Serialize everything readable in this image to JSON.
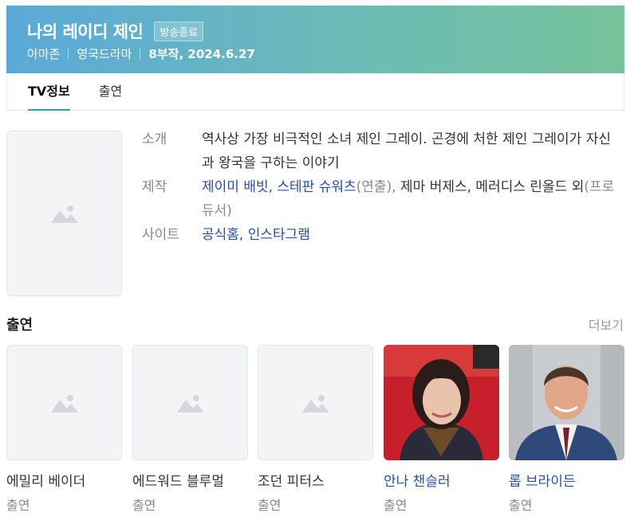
{
  "header": {
    "title": "나의 레이디 제인",
    "badge": "방송종료",
    "platform": "아마존",
    "genre": "영국드라마",
    "episodes_date": "8부작, 2024.6.27"
  },
  "tabs": [
    {
      "label": "TV정보",
      "active": true
    },
    {
      "label": "출연",
      "active": false
    }
  ],
  "info": {
    "intro_label": "소개",
    "intro_text": "역사상 가장 비극적인 소녀 제인 그레이. 곤경에 처한 제인 그레이가 자신과 왕국을 구하는 이야기",
    "production_label": "제작",
    "directors": "제이미 배빗, 스테판 슈워츠",
    "directors_role": "(연출), ",
    "producers": "제마 버제스, 메러디스 린올드  외",
    "producers_role": "(프로듀서)",
    "site_label": "사이트",
    "site_links": "공식홈, 인스타그램"
  },
  "cast_section": {
    "title": "출연",
    "more": "더보기"
  },
  "cast": [
    {
      "name": "에밀리 베이더",
      "role": "출연",
      "has_photo": false,
      "linked": false
    },
    {
      "name": "에드워드 블루멀",
      "role": "출연",
      "has_photo": false,
      "linked": false
    },
    {
      "name": "조던 피터스",
      "role": "출연",
      "has_photo": false,
      "linked": false
    },
    {
      "name": "안나 챈슬러",
      "role": "출연",
      "has_photo": true,
      "linked": true
    },
    {
      "name": "롭 브라이든",
      "role": "출연",
      "has_photo": true,
      "linked": true
    }
  ],
  "colors": {
    "header_gradient_start": "#5aa9d9",
    "header_gradient_end": "#76c29a",
    "tab_underline": "#22a5a5",
    "link": "#2a4fa8"
  },
  "icons": {
    "placeholder": "image-placeholder-icon"
  }
}
